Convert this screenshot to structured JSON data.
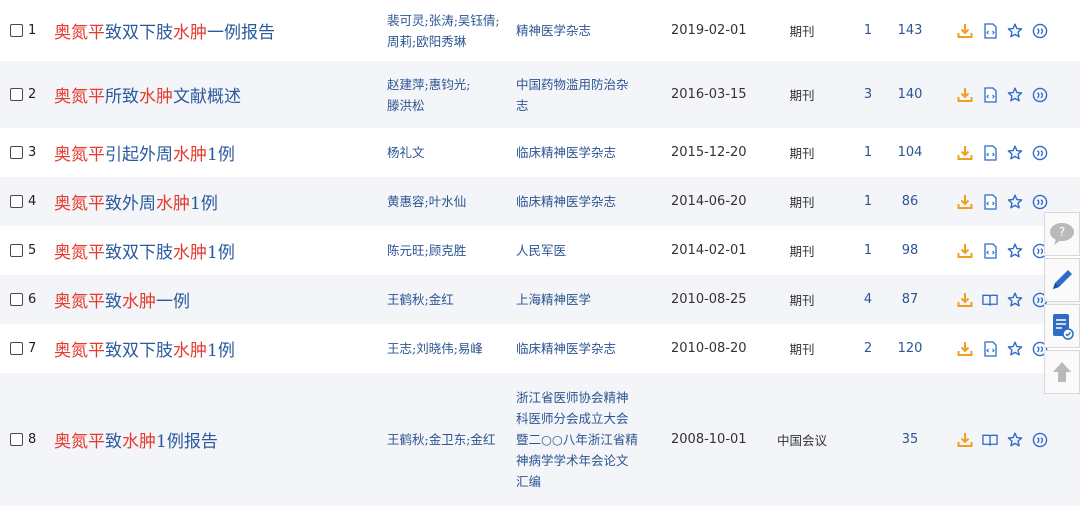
{
  "keyword_parts": [
    "奥氮平",
    "水肿"
  ],
  "rows": [
    {
      "num": "1",
      "title": [
        [
          "奥氮平",
          1
        ],
        [
          "致双下肢",
          0
        ],
        [
          "水肿",
          1
        ],
        [
          "一例报告",
          0
        ]
      ],
      "authors": [
        "裴可灵;张涛;吴钰倩;",
        "周莉;欧阳秀琳"
      ],
      "source": [
        "精神医学杂志"
      ],
      "date": "2019-02-01",
      "type": "期刊",
      "cites": "1",
      "downloads": "143",
      "read_icon": "html-icon"
    },
    {
      "num": "2",
      "title": [
        [
          "奥氮平",
          1
        ],
        [
          "所致",
          0
        ],
        [
          "水肿",
          1
        ],
        [
          "文献概述",
          0
        ]
      ],
      "authors": [
        "赵建萍;惠钧光;",
        "滕洪松"
      ],
      "source": [
        "中国药物滥用防治杂",
        "志"
      ],
      "date": "2016-03-15",
      "type": "期刊",
      "cites": "3",
      "downloads": "140",
      "read_icon": "html-icon"
    },
    {
      "num": "3",
      "title": [
        [
          "奥氮平",
          1
        ],
        [
          "引起外周",
          0
        ],
        [
          "水肿",
          1
        ],
        [
          "1例",
          0
        ]
      ],
      "authors": [
        "杨礼文"
      ],
      "source": [
        "临床精神医学杂志"
      ],
      "date": "2015-12-20",
      "type": "期刊",
      "cites": "1",
      "downloads": "104",
      "read_icon": "html-icon"
    },
    {
      "num": "4",
      "title": [
        [
          "奥氮平",
          1
        ],
        [
          "致外周",
          0
        ],
        [
          "水肿",
          1
        ],
        [
          "1例",
          0
        ]
      ],
      "authors": [
        "黄惠容;叶水仙"
      ],
      "source": [
        "临床精神医学杂志"
      ],
      "date": "2014-06-20",
      "type": "期刊",
      "cites": "1",
      "downloads": "86",
      "read_icon": "html-icon"
    },
    {
      "num": "5",
      "title": [
        [
          "奥氮平",
          1
        ],
        [
          "致双下肢",
          0
        ],
        [
          "水肿",
          1
        ],
        [
          "1例",
          0
        ]
      ],
      "authors": [
        "陈元旺;顾克胜"
      ],
      "source": [
        "人民军医"
      ],
      "date": "2014-02-01",
      "type": "期刊",
      "cites": "1",
      "downloads": "98",
      "read_icon": "html-icon"
    },
    {
      "num": "6",
      "title": [
        [
          "奥氮平",
          1
        ],
        [
          "致",
          0
        ],
        [
          "水肿",
          1
        ],
        [
          "一例",
          0
        ]
      ],
      "authors": [
        "王鹤秋;金红"
      ],
      "source": [
        "上海精神医学"
      ],
      "date": "2010-08-25",
      "type": "期刊",
      "cites": "4",
      "downloads": "87",
      "read_icon": "book-icon"
    },
    {
      "num": "7",
      "title": [
        [
          "奥氮平",
          1
        ],
        [
          "致双下肢",
          0
        ],
        [
          "水肿",
          1
        ],
        [
          "1例",
          0
        ]
      ],
      "authors": [
        "王志;刘晓伟;易峰"
      ],
      "source": [
        "临床精神医学杂志"
      ],
      "date": "2010-08-20",
      "type": "期刊",
      "cites": "2",
      "downloads": "120",
      "read_icon": "html-icon"
    },
    {
      "num": "8",
      "title": [
        [
          "奥氮平",
          1
        ],
        [
          "致",
          0
        ],
        [
          "水肿",
          1
        ],
        [
          "1例报告",
          0
        ]
      ],
      "authors": [
        "王鹤秋;金卫东;金红"
      ],
      "source": [
        "浙江省医师协会精神",
        "科医师分会成立大会",
        "暨二○○八年浙江省精",
        "神病学学术年会论文",
        "汇编"
      ],
      "date": "2008-10-01",
      "type": "中国会议",
      "cites": "",
      "downloads": "35",
      "read_icon": "book-icon"
    }
  ],
  "side_buttons": [
    "comment-icon",
    "edit-icon",
    "notes-icon",
    "back-to-top-icon"
  ],
  "colors": {
    "highlight": "#e63a2e",
    "link": "#2a5a9e",
    "download": "#f0a020",
    "icon_blue": "#2f6bc8",
    "row_alt": "#f3f5f8"
  }
}
